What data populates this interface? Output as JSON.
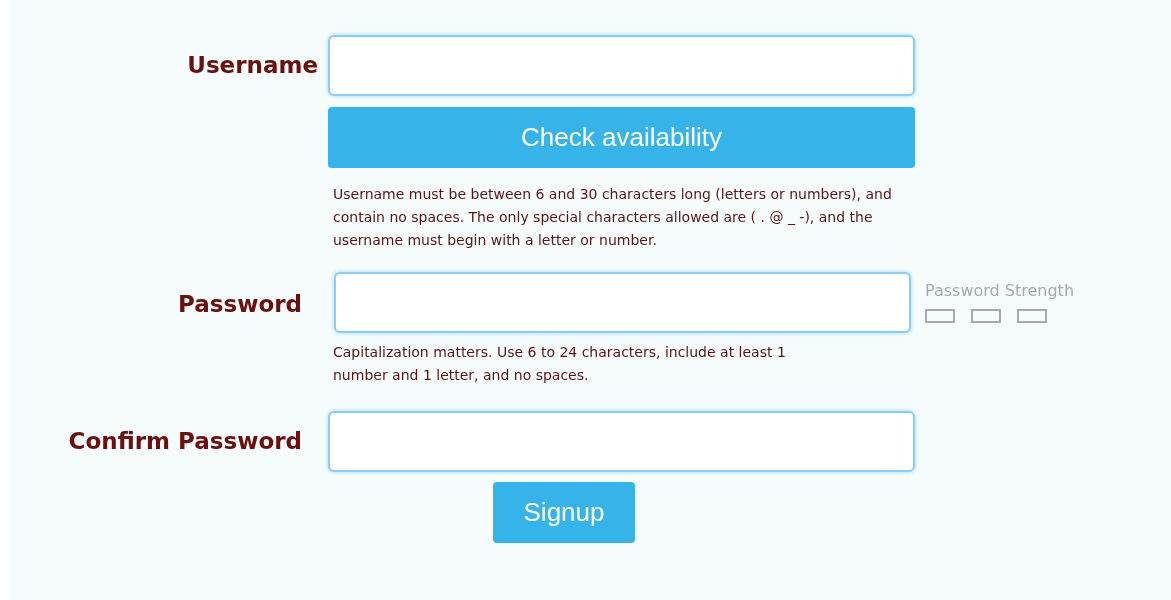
{
  "username": {
    "label": "Username",
    "button": "Check availability",
    "help": "Username must be between 6 and 30 characters long (letters or numbers), and contain no spaces. The only special characters allowed are ( . @ _ -), and the username must begin with a letter or number."
  },
  "password": {
    "label": "Password",
    "help": "Capitalization matters. Use 6 to 24 characters, include at least 1 number and 1 letter, and no spaces.",
    "strength_label": "Password Strength",
    "strength_bars": [
      {
        "filled": false
      },
      {
        "filled": false
      },
      {
        "filled": false
      }
    ]
  },
  "confirm": {
    "label": "Confirm Password"
  },
  "submit": "Signup"
}
